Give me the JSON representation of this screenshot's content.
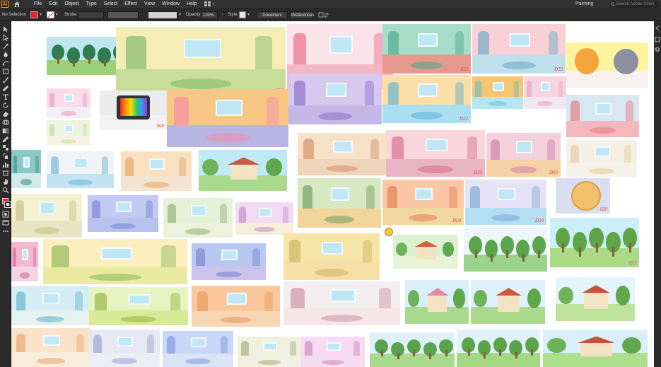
{
  "app": {
    "logo": "Ai"
  },
  "menubar": {
    "items": [
      "File",
      "Edit",
      "Object",
      "Type",
      "Select",
      "Effect",
      "View",
      "Window",
      "Help"
    ],
    "workspace": "Painting",
    "search_placeholder": "Search Adobe Stock"
  },
  "controlbar": {
    "selection": "No Selection",
    "stroke_label": "Stroke:",
    "opacity_label": "Opacity:",
    "opacity_value": "100%",
    "style_label": "Style:",
    "document_setup": "Document Setup",
    "preferences": "Preferences"
  },
  "colors": {
    "fill": "#e8232b",
    "chrome_dark": "#2a2a2a",
    "menubar": "#323232",
    "accent_logo": "#ff9a00"
  },
  "tools": [
    "selection-tool",
    "direct-selection-tool",
    "magic-wand-tool",
    "pen-tool",
    "curvature-tool",
    "rectangle-tool",
    "paintbrush-tool",
    "pencil-tool",
    "type-tool",
    "rotate-tool",
    "scale-tool",
    "eraser-tool",
    "shape-builder-tool",
    "live-paint-tool",
    "gradient-tool",
    "eyedropper-tool",
    "blend-tool",
    "symbol-sprayer-tool",
    "column-graph-tool",
    "artboard-tool",
    "slice-tool",
    "hand-tool",
    "zoom-tool"
  ],
  "artboards": {
    "labels": [
      "006",
      "004",
      "023",
      "D23",
      "D22",
      "D20",
      "D20",
      "D20",
      "D20",
      "020",
      "021",
      "025"
    ]
  }
}
